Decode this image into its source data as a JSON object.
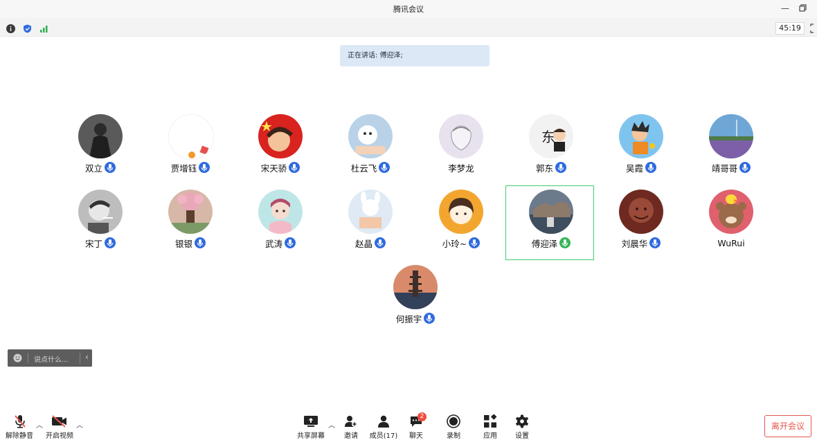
{
  "window": {
    "title": "腾讯会议"
  },
  "status": {
    "timer": "45:19"
  },
  "speaking": "正在讲话: 傅迎泽;",
  "participants": [
    {
      "name": "双立",
      "mic": "blue"
    },
    {
      "name": "贾增钰",
      "mic": "blue"
    },
    {
      "name": "宋天骄",
      "mic": "blue"
    },
    {
      "name": "杜云飞",
      "mic": "blue"
    },
    {
      "name": "李梦龙",
      "mic": "none"
    },
    {
      "name": "郭东",
      "mic": "blue"
    },
    {
      "name": "吴霞",
      "mic": "blue"
    },
    {
      "name": "靖哥哥",
      "mic": "blue"
    },
    {
      "name": "宋丁",
      "mic": "blue"
    },
    {
      "name": "银银",
      "mic": "blue"
    },
    {
      "name": "武涛",
      "mic": "blue"
    },
    {
      "name": "赵晶",
      "mic": "blue"
    },
    {
      "name": "小玲~",
      "mic": "blue"
    },
    {
      "name": "傅迎泽",
      "mic": "green"
    },
    {
      "name": "刘晨华",
      "mic": "blue"
    },
    {
      "name": "WuRui",
      "mic": "none"
    },
    {
      "name": "何振宇",
      "mic": "blue"
    }
  ],
  "chat_input": {
    "placeholder": "说点什么..."
  },
  "toolbar": {
    "unmute": "解除静音",
    "video": "开启视频",
    "share": "共享屏幕",
    "invite": "邀请",
    "members": "成员(17)",
    "chat": "聊天",
    "chat_badge": "2",
    "record": "录制",
    "apps": "应用",
    "settings": "设置",
    "leave": "离开会议"
  },
  "colors": {
    "accent": "#2f6be0",
    "speaking_mic": "#39b458",
    "leave": "#e4574b",
    "speaking_banner": "#dde8f6"
  }
}
